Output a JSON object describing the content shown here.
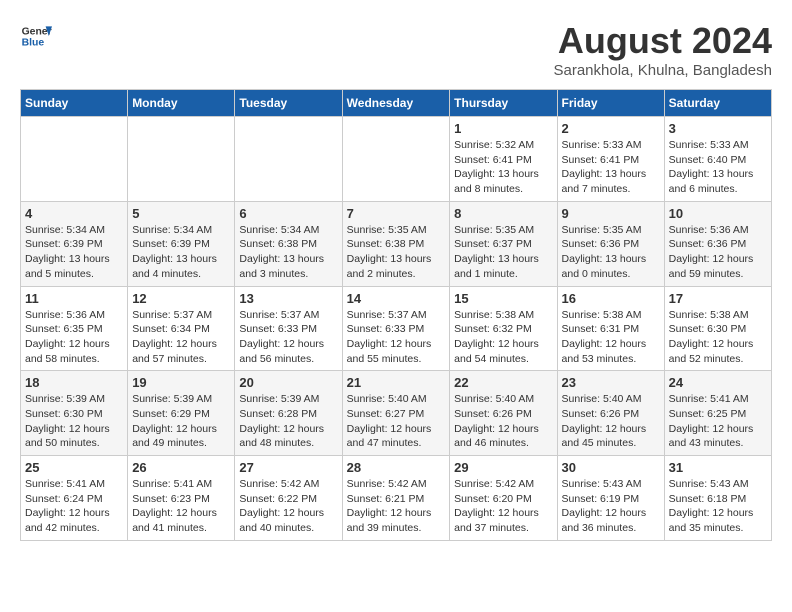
{
  "header": {
    "logo_line1": "General",
    "logo_line2": "Blue",
    "month_year": "August 2024",
    "location": "Sarankhola, Khulna, Bangladesh"
  },
  "weekdays": [
    "Sunday",
    "Monday",
    "Tuesday",
    "Wednesday",
    "Thursday",
    "Friday",
    "Saturday"
  ],
  "weeks": [
    [
      {
        "day": "",
        "info": ""
      },
      {
        "day": "",
        "info": ""
      },
      {
        "day": "",
        "info": ""
      },
      {
        "day": "",
        "info": ""
      },
      {
        "day": "1",
        "info": "Sunrise: 5:32 AM\nSunset: 6:41 PM\nDaylight: 13 hours\nand 8 minutes."
      },
      {
        "day": "2",
        "info": "Sunrise: 5:33 AM\nSunset: 6:41 PM\nDaylight: 13 hours\nand 7 minutes."
      },
      {
        "day": "3",
        "info": "Sunrise: 5:33 AM\nSunset: 6:40 PM\nDaylight: 13 hours\nand 6 minutes."
      }
    ],
    [
      {
        "day": "4",
        "info": "Sunrise: 5:34 AM\nSunset: 6:39 PM\nDaylight: 13 hours\nand 5 minutes."
      },
      {
        "day": "5",
        "info": "Sunrise: 5:34 AM\nSunset: 6:39 PM\nDaylight: 13 hours\nand 4 minutes."
      },
      {
        "day": "6",
        "info": "Sunrise: 5:34 AM\nSunset: 6:38 PM\nDaylight: 13 hours\nand 3 minutes."
      },
      {
        "day": "7",
        "info": "Sunrise: 5:35 AM\nSunset: 6:38 PM\nDaylight: 13 hours\nand 2 minutes."
      },
      {
        "day": "8",
        "info": "Sunrise: 5:35 AM\nSunset: 6:37 PM\nDaylight: 13 hours\nand 1 minute."
      },
      {
        "day": "9",
        "info": "Sunrise: 5:35 AM\nSunset: 6:36 PM\nDaylight: 13 hours\nand 0 minutes."
      },
      {
        "day": "10",
        "info": "Sunrise: 5:36 AM\nSunset: 6:36 PM\nDaylight: 12 hours\nand 59 minutes."
      }
    ],
    [
      {
        "day": "11",
        "info": "Sunrise: 5:36 AM\nSunset: 6:35 PM\nDaylight: 12 hours\nand 58 minutes."
      },
      {
        "day": "12",
        "info": "Sunrise: 5:37 AM\nSunset: 6:34 PM\nDaylight: 12 hours\nand 57 minutes."
      },
      {
        "day": "13",
        "info": "Sunrise: 5:37 AM\nSunset: 6:33 PM\nDaylight: 12 hours\nand 56 minutes."
      },
      {
        "day": "14",
        "info": "Sunrise: 5:37 AM\nSunset: 6:33 PM\nDaylight: 12 hours\nand 55 minutes."
      },
      {
        "day": "15",
        "info": "Sunrise: 5:38 AM\nSunset: 6:32 PM\nDaylight: 12 hours\nand 54 minutes."
      },
      {
        "day": "16",
        "info": "Sunrise: 5:38 AM\nSunset: 6:31 PM\nDaylight: 12 hours\nand 53 minutes."
      },
      {
        "day": "17",
        "info": "Sunrise: 5:38 AM\nSunset: 6:30 PM\nDaylight: 12 hours\nand 52 minutes."
      }
    ],
    [
      {
        "day": "18",
        "info": "Sunrise: 5:39 AM\nSunset: 6:30 PM\nDaylight: 12 hours\nand 50 minutes."
      },
      {
        "day": "19",
        "info": "Sunrise: 5:39 AM\nSunset: 6:29 PM\nDaylight: 12 hours\nand 49 minutes."
      },
      {
        "day": "20",
        "info": "Sunrise: 5:39 AM\nSunset: 6:28 PM\nDaylight: 12 hours\nand 48 minutes."
      },
      {
        "day": "21",
        "info": "Sunrise: 5:40 AM\nSunset: 6:27 PM\nDaylight: 12 hours\nand 47 minutes."
      },
      {
        "day": "22",
        "info": "Sunrise: 5:40 AM\nSunset: 6:26 PM\nDaylight: 12 hours\nand 46 minutes."
      },
      {
        "day": "23",
        "info": "Sunrise: 5:40 AM\nSunset: 6:26 PM\nDaylight: 12 hours\nand 45 minutes."
      },
      {
        "day": "24",
        "info": "Sunrise: 5:41 AM\nSunset: 6:25 PM\nDaylight: 12 hours\nand 43 minutes."
      }
    ],
    [
      {
        "day": "25",
        "info": "Sunrise: 5:41 AM\nSunset: 6:24 PM\nDaylight: 12 hours\nand 42 minutes."
      },
      {
        "day": "26",
        "info": "Sunrise: 5:41 AM\nSunset: 6:23 PM\nDaylight: 12 hours\nand 41 minutes."
      },
      {
        "day": "27",
        "info": "Sunrise: 5:42 AM\nSunset: 6:22 PM\nDaylight: 12 hours\nand 40 minutes."
      },
      {
        "day": "28",
        "info": "Sunrise: 5:42 AM\nSunset: 6:21 PM\nDaylight: 12 hours\nand 39 minutes."
      },
      {
        "day": "29",
        "info": "Sunrise: 5:42 AM\nSunset: 6:20 PM\nDaylight: 12 hours\nand 37 minutes."
      },
      {
        "day": "30",
        "info": "Sunrise: 5:43 AM\nSunset: 6:19 PM\nDaylight: 12 hours\nand 36 minutes."
      },
      {
        "day": "31",
        "info": "Sunrise: 5:43 AM\nSunset: 6:18 PM\nDaylight: 12 hours\nand 35 minutes."
      }
    ]
  ]
}
